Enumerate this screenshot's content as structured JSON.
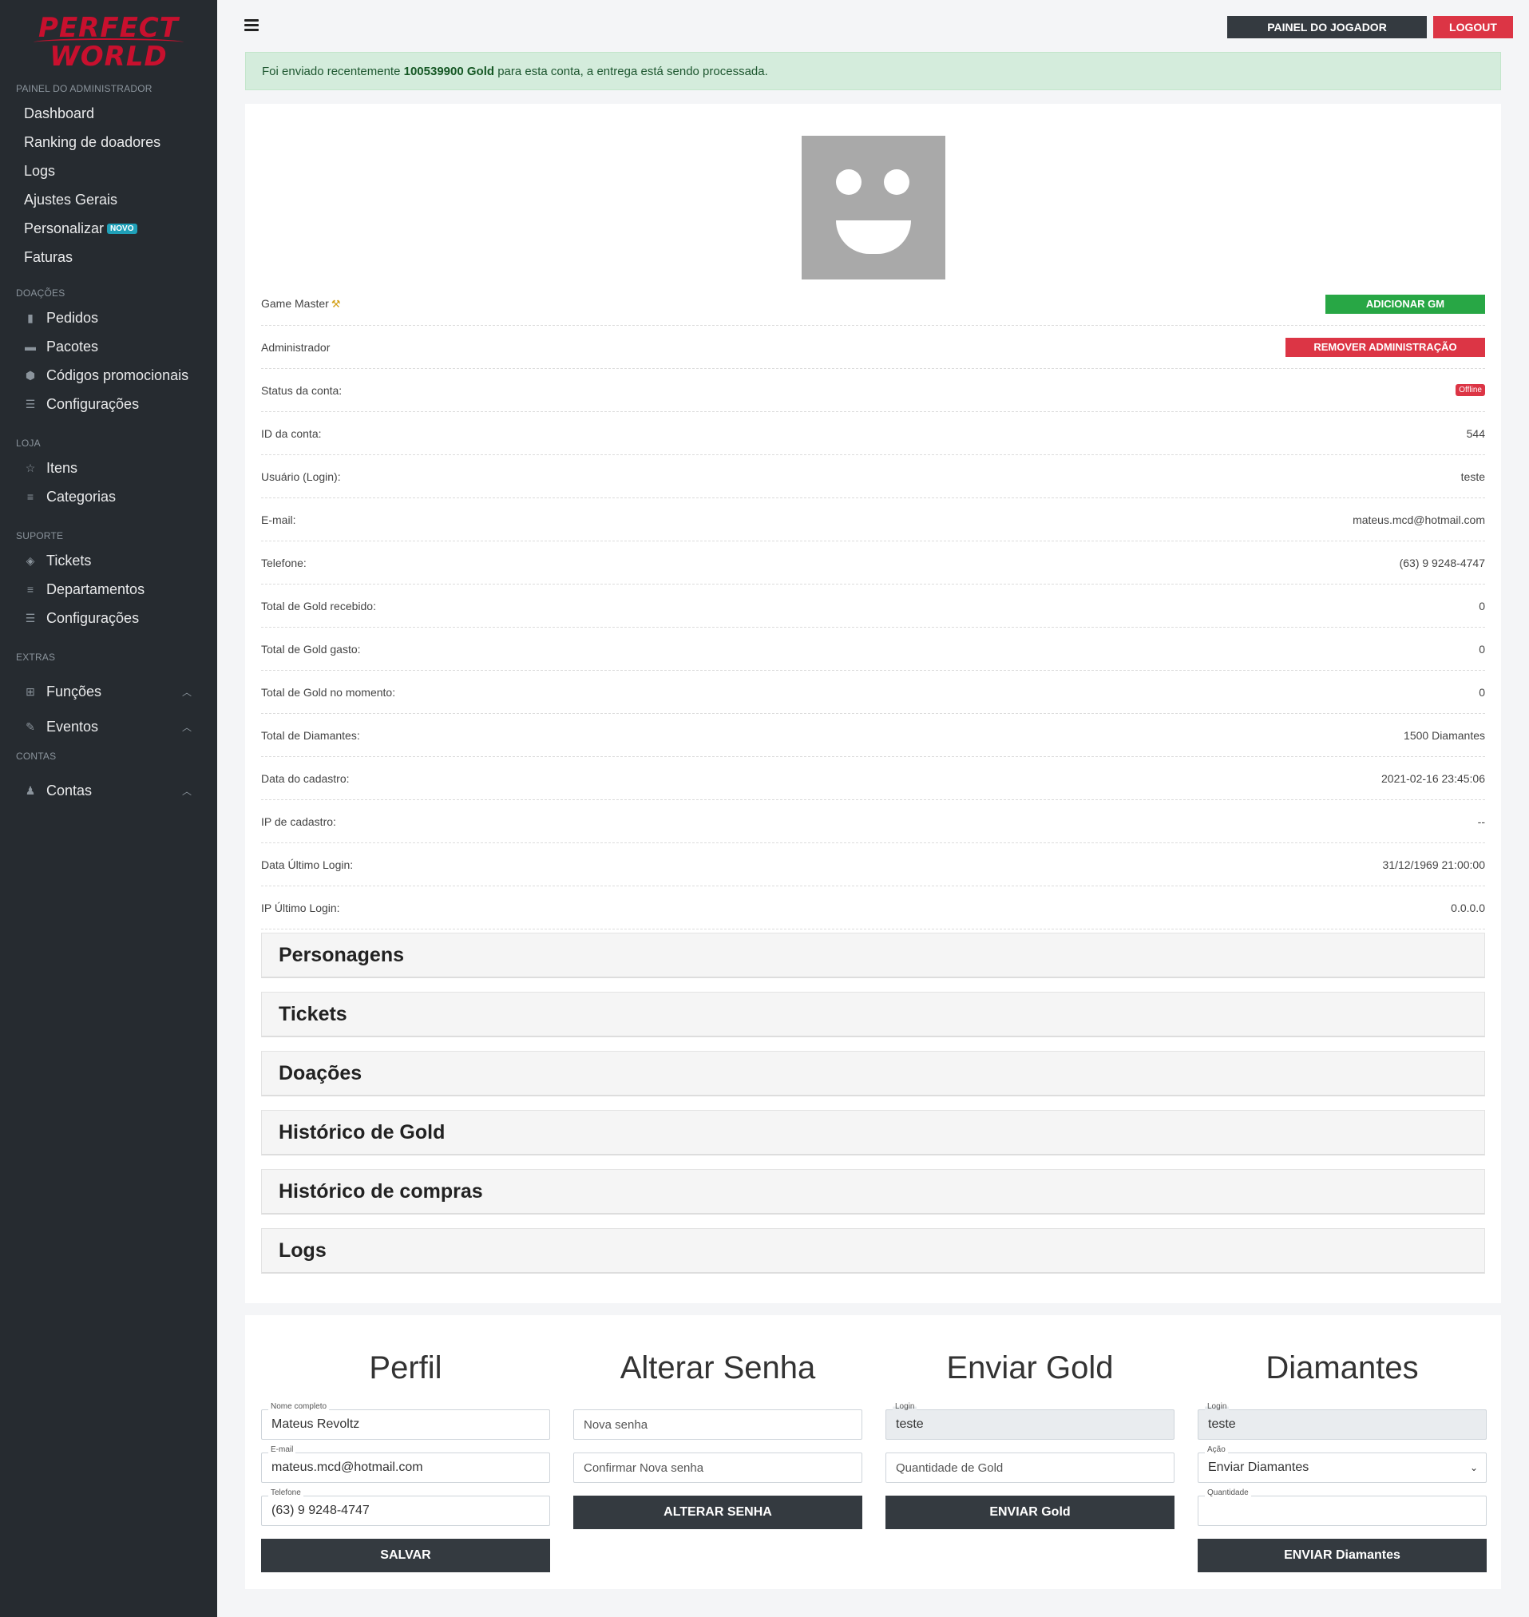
{
  "brand": {
    "line1": "PERFECT",
    "line2": "WORLD"
  },
  "sidebar": {
    "admin_title": "PAINEL DO ADMINISTRADOR",
    "admin_items": [
      "Dashboard",
      "Ranking de doadores",
      "Logs",
      "Ajustes Gerais",
      "Personalizar",
      "Faturas"
    ],
    "novo_badge": "NOVO",
    "donations_title": "DOAÇÕES",
    "donations_items": [
      "Pedidos",
      "Pacotes",
      "Códigos promocionais",
      "Configurações"
    ],
    "store_title": "LOJA",
    "store_items": [
      "Itens",
      "Categorias"
    ],
    "support_title": "SUPORTE",
    "support_items": [
      "Tickets",
      "Departamentos",
      "Configurações"
    ],
    "extras_title": "EXTRAS",
    "extras_items": [
      "Funções",
      "Eventos"
    ],
    "accounts_title": "CONTAS",
    "accounts_items": [
      "Contas"
    ]
  },
  "topbar": {
    "player_panel": "PAINEL DO JOGADOR",
    "logout": "LOGOUT"
  },
  "alert": {
    "prefix": "Foi enviado recentemente ",
    "amount": "100539900 Gold",
    "suffix": " para esta conta, a entrega está sendo processada."
  },
  "account": {
    "game_master_label": "Game Master",
    "add_gm": "ADICIONAR GM",
    "admin_label": "Administrador",
    "remove_admin": "REMOVER ADMINISTRAÇÃO",
    "status_label": "Status da conta:",
    "status_value": "Offline",
    "rows": [
      {
        "label": "ID da conta:",
        "value": "544"
      },
      {
        "label": "Usuário (Login):",
        "value": "teste"
      },
      {
        "label": "E-mail:",
        "value": "mateus.mcd@hotmail.com"
      },
      {
        "label": "Telefone:",
        "value": "(63) 9 9248-4747"
      },
      {
        "label": "Total de Gold recebido:",
        "value": "0"
      },
      {
        "label": "Total de Gold gasto:",
        "value": "0"
      },
      {
        "label": "Total de Gold no momento:",
        "value": "0"
      },
      {
        "label": "Total de Diamantes:",
        "value": "1500 Diamantes"
      },
      {
        "label": "Data do cadastro:",
        "value": "2021-02-16 23:45:06"
      },
      {
        "label": "IP de cadastro:",
        "value": "--"
      },
      {
        "label": "Data Último Login:",
        "value": "31/12/1969 21:00:00"
      },
      {
        "label": "IP Último Login:",
        "value": "0.0.0.0"
      }
    ]
  },
  "sections": [
    "Personagens",
    "Tickets",
    "Doações",
    "Histórico de Gold",
    "Histórico de compras",
    "Logs"
  ],
  "forms": {
    "perfil": {
      "title": "Perfil",
      "name_caption": "Nome completo",
      "name_value": "Mateus Revoltz",
      "email_caption": "E-mail",
      "email_value": "mateus.mcd@hotmail.com",
      "phone_caption": "Telefone",
      "phone_value": "(63) 9 9248-4747",
      "save": "SALVAR"
    },
    "senha": {
      "title": "Alterar Senha",
      "new_placeholder": "Nova senha",
      "confirm_placeholder": "Confirmar Nova senha",
      "submit": "ALTERAR SENHA"
    },
    "gold": {
      "title": "Enviar Gold",
      "login_caption": "Login",
      "login_value": "teste",
      "amount_placeholder": "Quantidade de Gold",
      "submit": "ENVIAR Gold"
    },
    "diamantes": {
      "title": "Diamantes",
      "login_caption": "Login",
      "login_value": "teste",
      "action_caption": "Ação",
      "action_value": "Enviar Diamantes",
      "qty_caption": "Quantidade",
      "qty_value": "",
      "submit": "ENVIAR Diamantes"
    }
  }
}
